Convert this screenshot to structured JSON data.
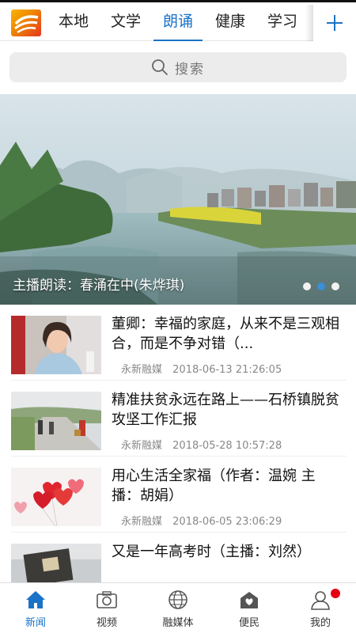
{
  "header": {
    "logo_icon": "app-logo-icon",
    "tabs": [
      {
        "label": "本地"
      },
      {
        "label": "文学"
      },
      {
        "label": "朗诵"
      },
      {
        "label": "健康"
      },
      {
        "label": "学习"
      }
    ],
    "active_tab": 2,
    "add_icon": "plus-icon"
  },
  "search": {
    "icon": "search-icon",
    "placeholder": "搜索"
  },
  "banner": {
    "caption": "主播朗读：春涌在中(朱烨琪)",
    "slide_count": 3,
    "active_slide": 2
  },
  "news": [
    {
      "title": "董卿：幸福的家庭，从来不是三观相合，而是不争对错（...",
      "source": "永新融媒",
      "time": "2018-06-13 21:26:05",
      "thumb": "woman-portrait-photo"
    },
    {
      "title": "精准扶贫永远在路上——石桥镇脱贫攻坚工作汇报",
      "source": "永新融媒",
      "time": "2018-05-28 10:57:28",
      "thumb": "village-road-photo"
    },
    {
      "title": "用心生活全家福（作者：温婉 主播：胡娟）",
      "source": "永新融媒",
      "time": "2018-06-05 23:06:29",
      "thumb": "heart-balloons-photo"
    },
    {
      "title": "又是一年高考时（主播：刘然）",
      "source": "",
      "time": "",
      "thumb": "desk-book-photo"
    }
  ],
  "bottom_nav": [
    {
      "label": "新闻",
      "icon": "home-icon"
    },
    {
      "label": "视频",
      "icon": "camera-icon"
    },
    {
      "label": "融媒体",
      "icon": "globe-icon"
    },
    {
      "label": "便民",
      "icon": "service-house-icon"
    },
    {
      "label": "我的",
      "icon": "user-icon"
    }
  ],
  "colors": {
    "accent": "#1a73c8",
    "badge": "#e60012"
  }
}
